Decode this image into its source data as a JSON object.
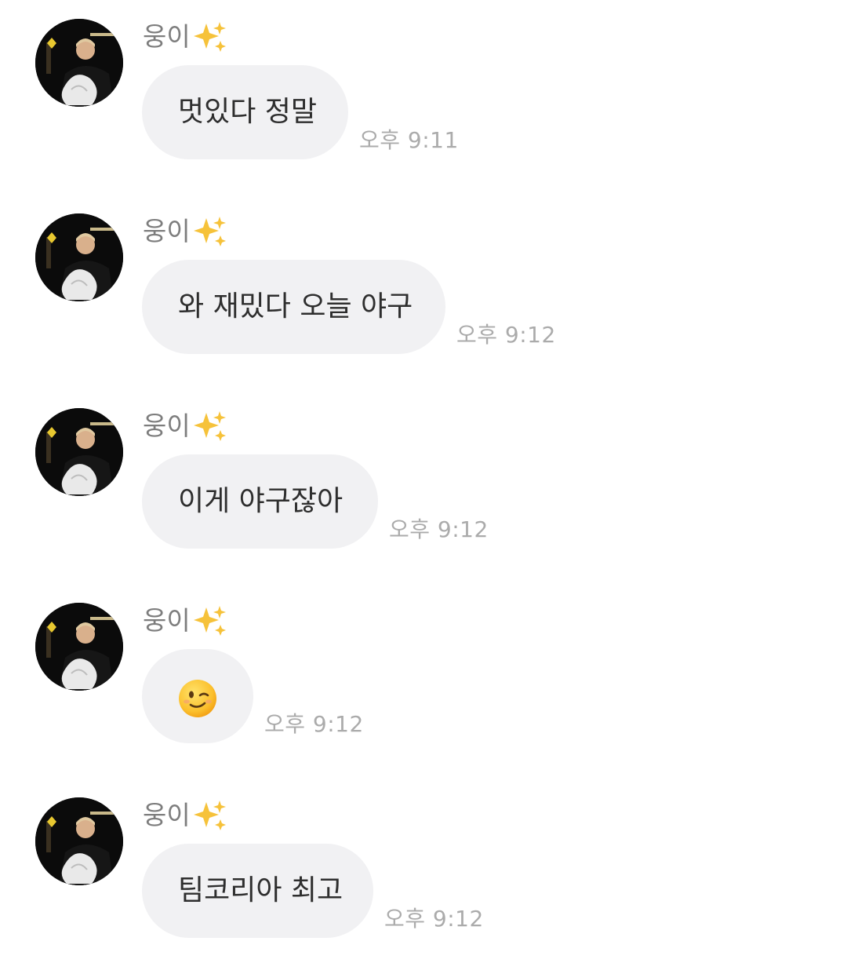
{
  "colors": {
    "bubble": "#f1f1f3",
    "sender": "#7d7d7d",
    "time": "#ababab",
    "message_text": "#2e2e2e"
  },
  "avatar_icon": "profile-photo",
  "sender_icon": "sparkles-icon",
  "messages": [
    {
      "sender": "웅이",
      "text": "멋있다 정말",
      "time": "오후 9:11"
    },
    {
      "sender": "웅이",
      "text": "와 재밌다 오늘 야구",
      "time": "오후 9:12"
    },
    {
      "sender": "웅이",
      "text": "이게 야구잖아",
      "time": "오후 9:12"
    },
    {
      "sender": "웅이",
      "text": "",
      "emoji": "winking-face-icon",
      "time": "오후 9:12"
    },
    {
      "sender": "웅이",
      "text": "팀코리아 최고",
      "time": "오후 9:12"
    }
  ]
}
